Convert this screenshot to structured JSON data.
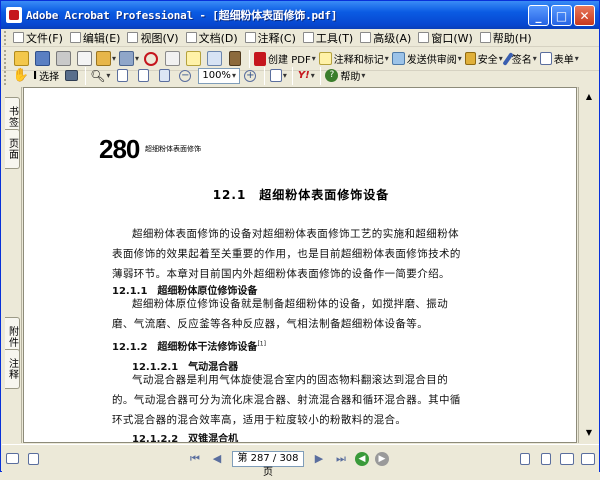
{
  "window": {
    "title": "Adobe Acrobat Professional - [超细粉体表面修饰.pdf]"
  },
  "title_buttons": {
    "minimize": "_",
    "maximize": "□",
    "close": "✕"
  },
  "menu": [
    {
      "label": "文件(F)",
      "icon": "file-menu-icon"
    },
    {
      "label": "编辑(E)",
      "icon": "edit-menu-icon"
    },
    {
      "label": "视图(V)",
      "icon": "view-menu-icon"
    },
    {
      "label": "文档(D)",
      "icon": "document-menu-icon"
    },
    {
      "label": "注释(C)",
      "icon": "comment-menu-icon"
    },
    {
      "label": "工具(T)",
      "icon": "tools-menu-icon"
    },
    {
      "label": "高级(A)",
      "icon": "advanced-menu-icon"
    },
    {
      "label": "窗口(W)",
      "icon": "window-menu-icon"
    },
    {
      "label": "帮助(H)",
      "icon": "help-menu-icon"
    }
  ],
  "toolbar1": {
    "create_pdf": "创建 PDF",
    "comment_markup": "注释和标记",
    "send_review": "发送供审阅",
    "secure": "安全",
    "sign": "签名",
    "forms": "表单"
  },
  "toolbar2": {
    "select": "选择",
    "zoom": "100%",
    "help": "帮助"
  },
  "left_tabs": {
    "bookmarks": "书签",
    "pages": "页面",
    "attachments": "附件",
    "comments": "注释"
  },
  "document": {
    "page_number": "280",
    "running_head": "超细粉体表面修饰",
    "chapter_title": "12.1　超细粉体表面修饰设备",
    "intro_lines": [
      "超细粉体表面修饰的设备对超细粉体表面修饰工艺的实施和超细粉体",
      "表面修饰的效果起着至关重要的作用，也是目前超细粉体表面修饰技术的",
      "薄弱环节。本章对目前国内外超细粉体表面修饰的设备作一简要介绍。"
    ],
    "sec_1_1": "12.1.1　超细粉体原位修饰设备",
    "sec_1_1_lines": [
      "超细粉体原位修饰设备就是制备超细粉体的设备，如搅拌磨、振动",
      "磨、气流磨、反应釜等各种反应器，气相法制备超细粉体设备等。"
    ],
    "sec_1_2": "12.1.2　超细粉体干法修饰设备",
    "sec_1_2_ref": "[1]",
    "sec_1_2_1": "12.1.2.1　气动混合器",
    "sec_1_2_1_lines": [
      "气动混合器是利用气体旋使混合室内的固态物料翻滚达到混合目的",
      "的。气动混合器可分为流化床混合器、射流混合器和循环混合器。其中循",
      "环式混合器的混合效率高，适用于粒度较小的粉散料的混合。"
    ],
    "sec_1_2_2": "12.1.2.2　双锥混合机"
  },
  "status": {
    "page_indicator": "第 287 / 308 页"
  },
  "colors": {
    "titlebar": "#0A5BE3",
    "acrobat_red": "#C5161D",
    "close_button": "#C8381C"
  }
}
